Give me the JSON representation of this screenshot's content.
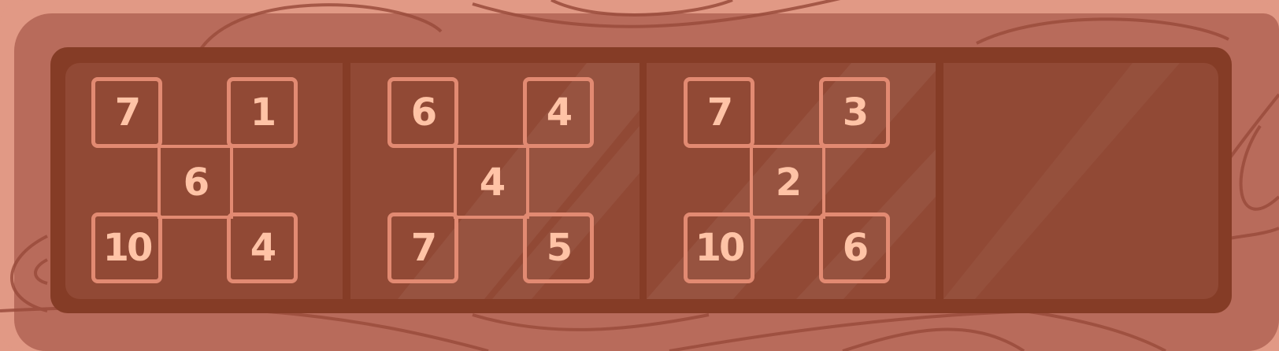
{
  "puzzles": [
    {
      "top_left": "7",
      "top_right": "1",
      "center": "6",
      "bottom_left": "10",
      "bottom_right": "4"
    },
    {
      "top_left": "6",
      "top_right": "4",
      "center": "4",
      "bottom_left": "7",
      "bottom_right": "5"
    },
    {
      "top_left": "7",
      "top_right": "3",
      "center": "2",
      "bottom_left": "10",
      "bottom_right": "6"
    }
  ],
  "colors": {
    "background": "#e19985",
    "frame": "#853c26",
    "panel": "#914935",
    "tile_border": "#e28a72",
    "digit": "#ffc3a6"
  }
}
